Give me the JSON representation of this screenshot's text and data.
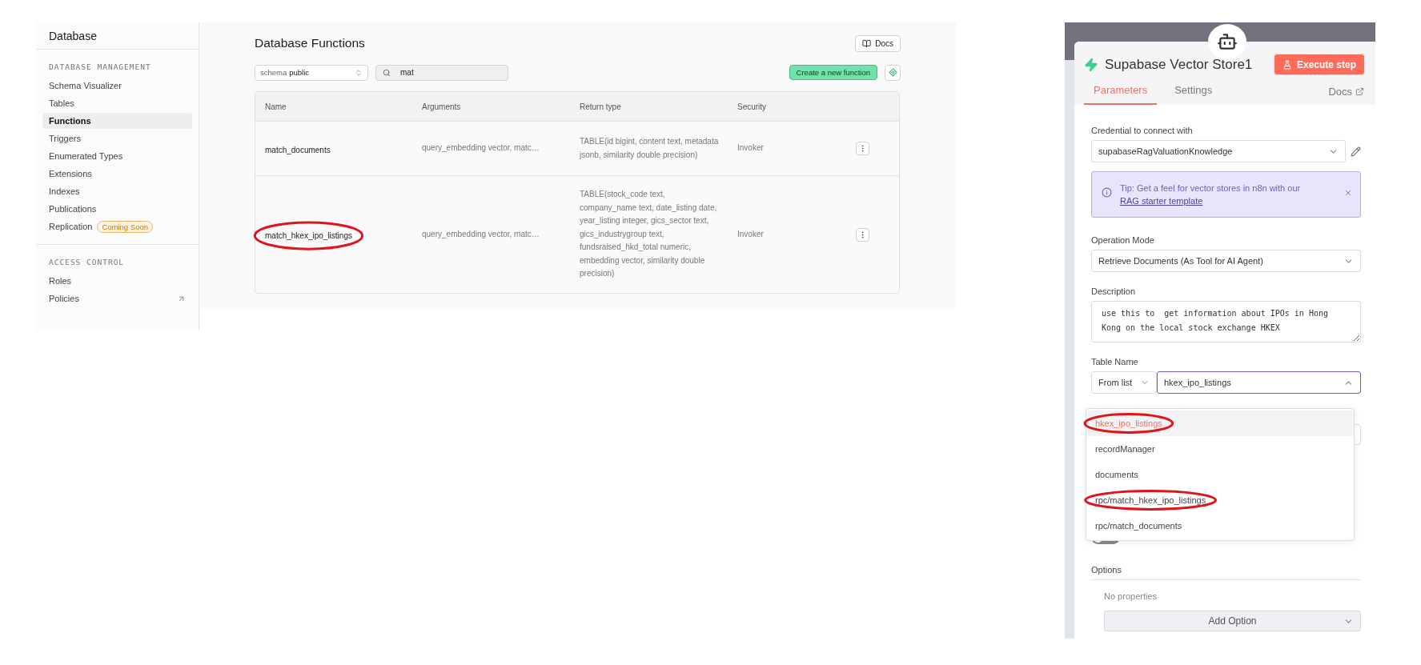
{
  "database_sidebar": {
    "title": "Database",
    "sections": [
      {
        "heading": "DATABASE MANAGEMENT",
        "items": [
          {
            "label": "Schema Visualizer",
            "selected": false,
            "external": false
          },
          {
            "label": "Tables",
            "selected": false,
            "external": false
          },
          {
            "label": "Functions",
            "selected": true,
            "external": false
          },
          {
            "label": "Triggers",
            "selected": false,
            "external": false
          },
          {
            "label": "Enumerated Types",
            "selected": false,
            "external": false
          },
          {
            "label": "Extensions",
            "selected": false,
            "external": false
          },
          {
            "label": "Indexes",
            "selected": false,
            "external": false
          },
          {
            "label": "Publications",
            "selected": false,
            "external": false
          },
          {
            "label": "Replication",
            "selected": false,
            "external": false,
            "badge": "Coming Soon"
          }
        ]
      },
      {
        "heading": "ACCESS CONTROL",
        "items": [
          {
            "label": "Roles",
            "selected": false,
            "external": false
          },
          {
            "label": "Policies",
            "selected": false,
            "external": true
          }
        ]
      }
    ]
  },
  "functions_page": {
    "title": "Database Functions",
    "docs_button": "Docs",
    "schema_select": {
      "prefix": "schema",
      "value": "public"
    },
    "search": {
      "value": "mat"
    },
    "create_button": "Create a new function",
    "table": {
      "columns": [
        "Name",
        "Arguments",
        "Return type",
        "Security"
      ],
      "rows": [
        {
          "name": "match_documents",
          "arguments": "query_embedding vector, matc…",
          "return_type": "TABLE(id bigint, content text, metadata jsonb, similarity double precision)",
          "security": "Invoker",
          "circled": false
        },
        {
          "name": "match_hkex_ipo_listings",
          "arguments": "query_embedding vector, matc…",
          "return_type": "TABLE(stock_code text, company_name text, date_listing date, year_listing integer, gics_sector text, gics_industrygroup text, fundsraised_hkd_total numeric, embedding vector, similarity double precision)",
          "security": "Invoker",
          "circled": true
        }
      ]
    }
  },
  "node_panel": {
    "title": "Supabase Vector Store1",
    "execute_button": "Execute step",
    "tabs": [
      {
        "label": "Parameters",
        "selected": true
      },
      {
        "label": "Settings",
        "selected": false
      }
    ],
    "docs_link": "Docs",
    "credential": {
      "label": "Credential to connect with",
      "value": "supabaseRagValuationKnowledge"
    },
    "tip": {
      "text": "Tip: Get a feel for vector stores in n8n with our",
      "link": "RAG starter template"
    },
    "operation_mode": {
      "label": "Operation Mode",
      "value": "Retrieve Documents (As Tool for AI Agent)"
    },
    "description": {
      "label": "Description",
      "value": "use this to  get information about IPOs in Hong Kong on the local stock exchange HKEX"
    },
    "table_name": {
      "label": "Table Name",
      "mode": "From list",
      "value": "hkex_ipo_listings",
      "options": [
        {
          "label": "hkex_ipo_listings",
          "selected": true,
          "circled": true
        },
        {
          "label": "recordManager",
          "selected": false,
          "circled": false
        },
        {
          "label": "documents",
          "selected": false,
          "circled": false
        },
        {
          "label": "rpc/match_hkex_ipo_listings",
          "selected": false,
          "circled": true
        },
        {
          "label": "rpc/match_documents",
          "selected": false,
          "circled": false
        }
      ]
    },
    "toggle": {
      "on": false
    },
    "options": {
      "label": "Options",
      "empty_text": "No properties",
      "add_button": "Add Option"
    }
  }
}
